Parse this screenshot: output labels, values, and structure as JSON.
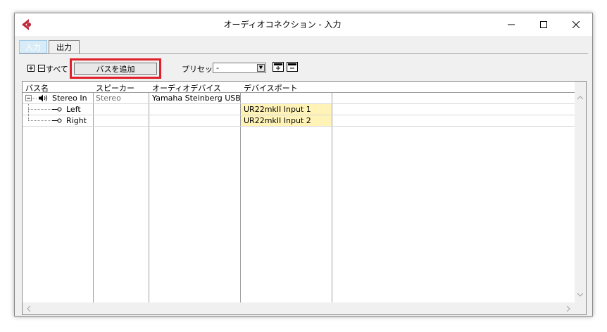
{
  "window": {
    "title": "オーディオコネクション - 入力"
  },
  "tabs": [
    {
      "label": "入力"
    },
    {
      "label": "出力"
    }
  ],
  "toolbar": {
    "all_label": "すべて",
    "add_bus_label": "バスを追加",
    "preset_label": "プリセット",
    "preset_value": "-"
  },
  "table": {
    "headers": [
      "バス名",
      "スピーカー",
      "オーディオデバイス",
      "デバイスポート"
    ],
    "rows": [
      {
        "bus": "Stereo In",
        "speaker": "Stereo",
        "device": "Yamaha Steinberg USB ASIO",
        "port": ""
      },
      {
        "bus": "Left",
        "speaker": "",
        "device": "",
        "port": "UR22mkII Input 1"
      },
      {
        "bus": "Right",
        "speaker": "",
        "device": "",
        "port": "UR22mkII Input 2"
      }
    ]
  },
  "colors": {
    "accent_red": "#e0202a",
    "port_highlight": "#fff3b8",
    "app_icon": "#c0283c"
  }
}
